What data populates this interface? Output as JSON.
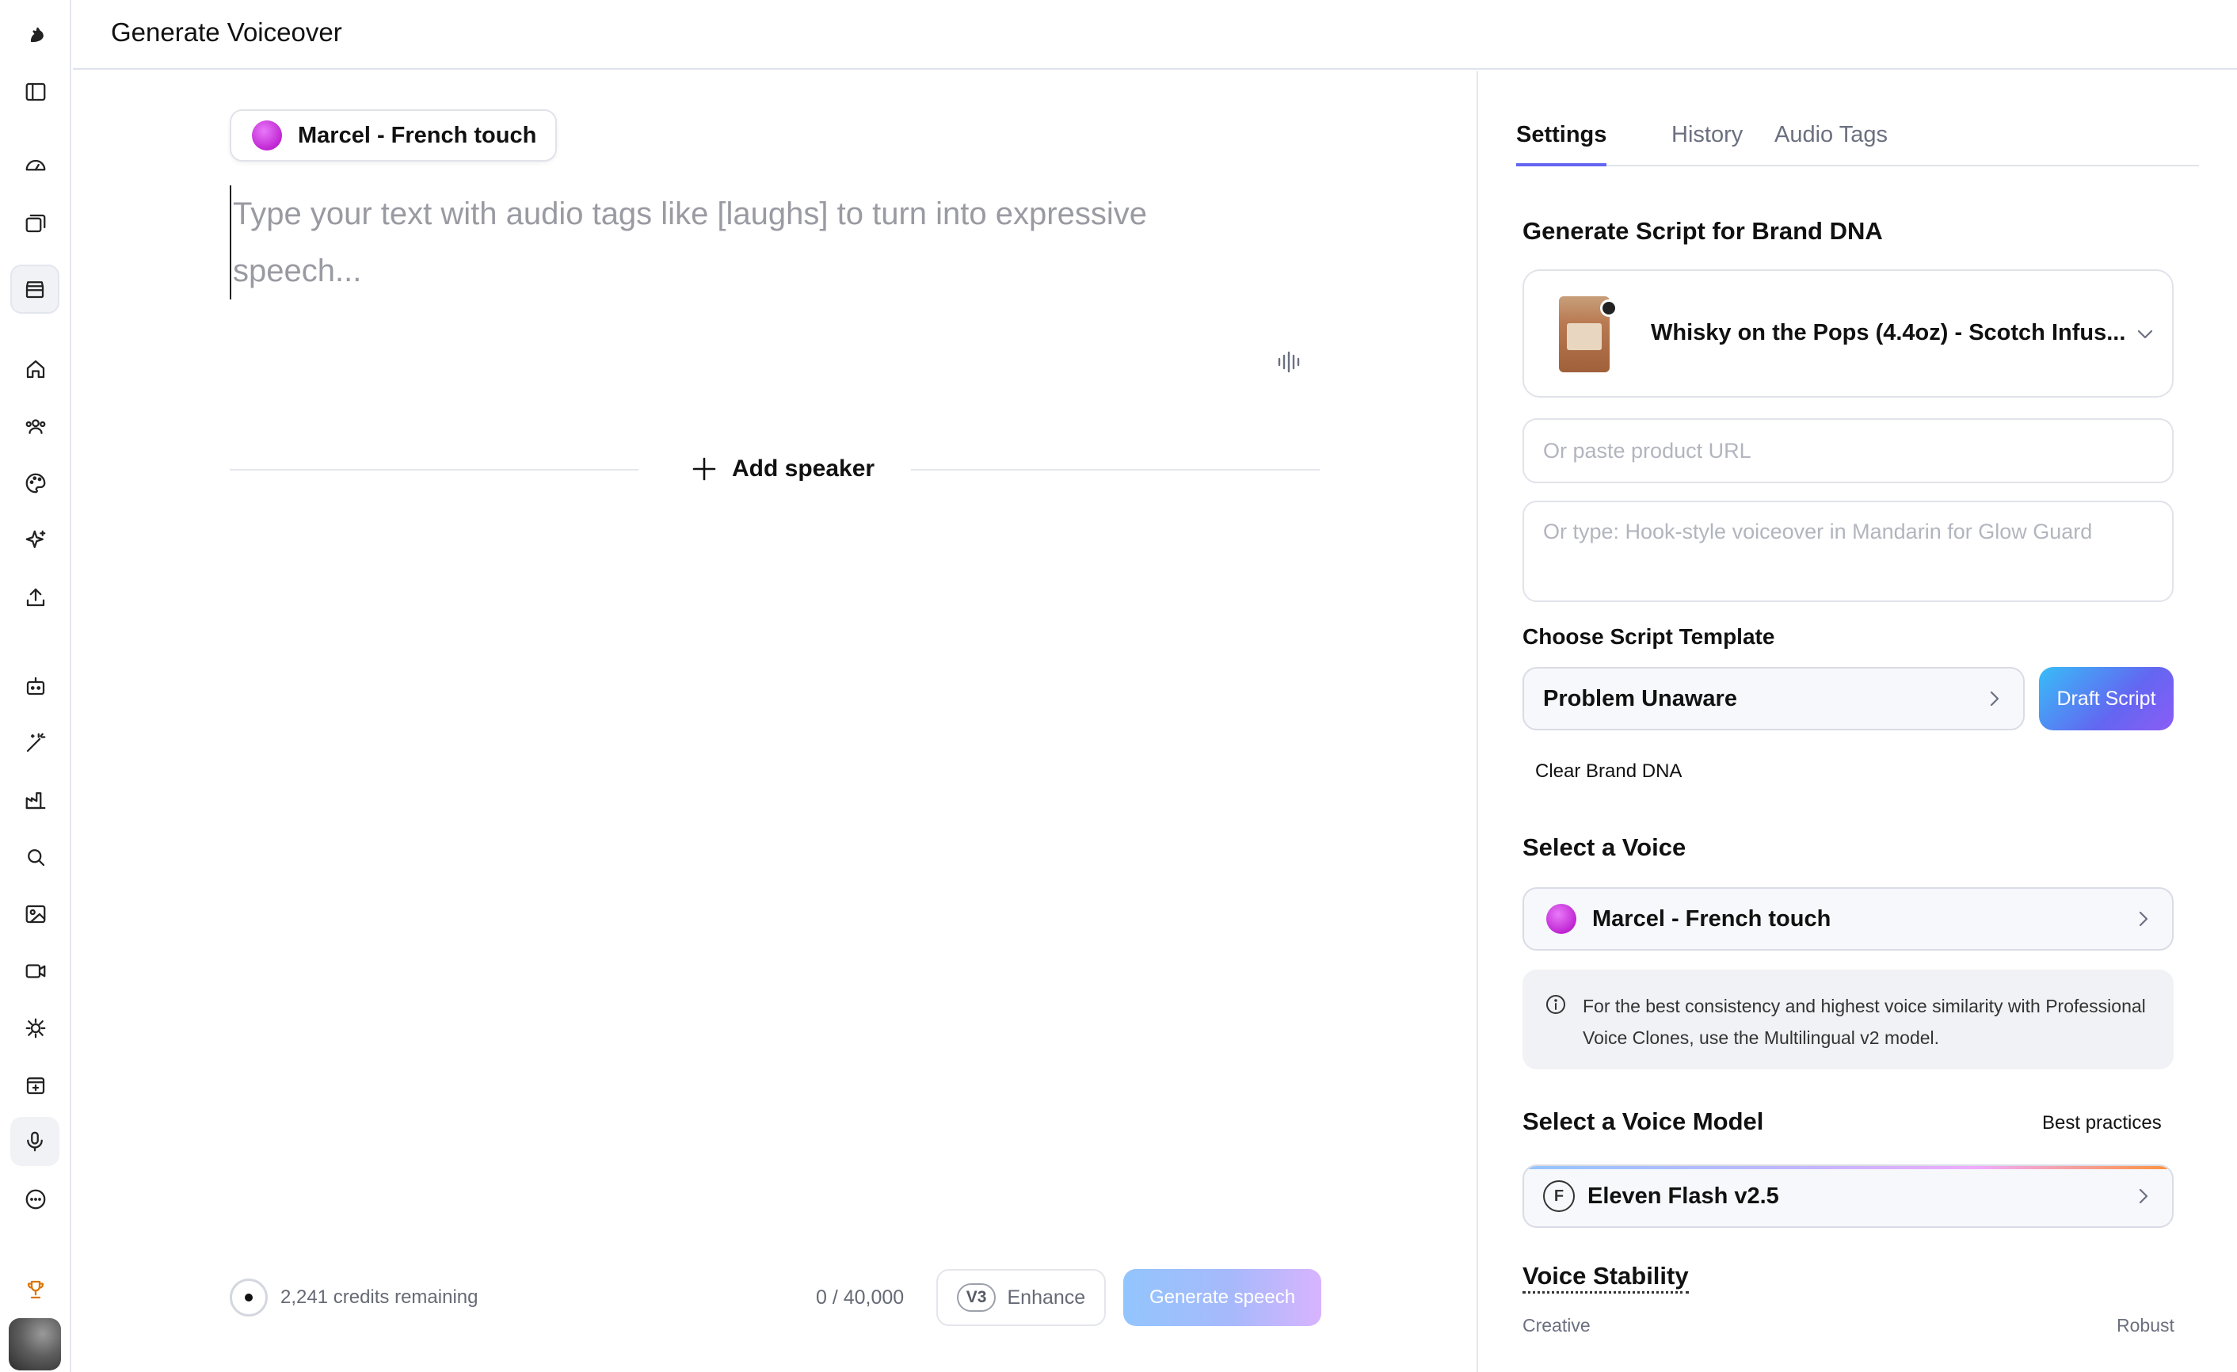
{
  "header": {
    "title": "Generate Voiceover"
  },
  "sidebar": {
    "icons": [
      "logo-icon",
      "sidebar-toggle-icon",
      "dashboard-gauge-icon",
      "library-icon",
      "store-icon",
      "home-icon",
      "users-icon",
      "palette-icon",
      "sparkles-icon",
      "upload-icon",
      "robot-icon",
      "magic-wand-icon",
      "factory-icon",
      "search-icon",
      "image-icon",
      "video-icon",
      "bug-icon",
      "calendar-icon",
      "microphone-icon",
      "more-icon",
      "trophy-icon"
    ]
  },
  "editor": {
    "speaker_name": "Marcel - French touch",
    "placeholder": "Type your text with audio tags like [laughs] to turn into expressive speech...",
    "add_speaker_label": "Add speaker",
    "credits_text": "2,241 credits remaining",
    "char_count": "0 / 40,000",
    "enhance_badge": "V3",
    "enhance_label": "Enhance",
    "generate_label": "Generate speech"
  },
  "panel": {
    "tabs": [
      "Settings",
      "History",
      "Audio Tags"
    ],
    "active_tab": "Settings",
    "brand_dna_title": "Generate Script for Brand DNA",
    "product_name": "Whisky on the Pops (4.4oz) - Scotch Infus...",
    "url_placeholder": "Or paste product URL",
    "prompt_placeholder": "Or type: Hook-style voiceover in Mandarin for Glow Guard",
    "template_label": "Choose Script Template",
    "template_value": "Problem Unaware",
    "draft_label": "Draft Script",
    "clear_label": "Clear Brand DNA",
    "voice_title": "Select a Voice",
    "voice_value": "Marcel - French touch",
    "info_text": "For the best consistency and highest voice similarity with Professional Voice Clones, use the Multilingual v2 model.",
    "model_title": "Select a Voice Model",
    "best_practices": "Best practices",
    "model_badge": "F",
    "model_value": "Eleven Flash v2.5",
    "stability_title": "Voice Stability",
    "scale_left": "Creative",
    "scale_right": "Robust"
  },
  "colors": {
    "accent": "#6366f1",
    "voice_dot": "#c026d3",
    "generate_gradient_start": "#93c5fd",
    "generate_gradient_end": "#d8b4fe"
  }
}
